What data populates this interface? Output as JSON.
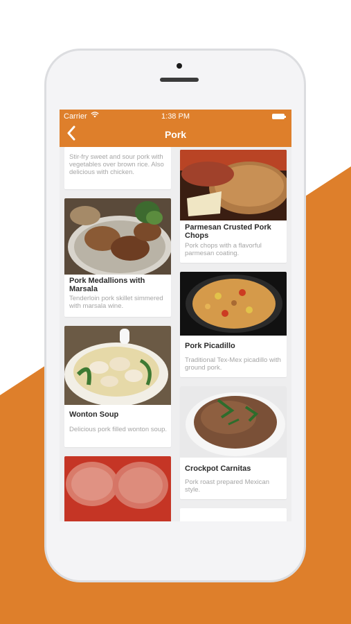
{
  "status_bar": {
    "carrier": "Carrier",
    "wifi": "wifi-icon",
    "time": "1:38 PM",
    "battery": "battery-icon"
  },
  "nav": {
    "back_icon": "chevron-left-icon",
    "title": "Pork"
  },
  "colors": {
    "accent": "#de7f2b",
    "card_bg": "#ffffff",
    "screen_bg": "#eeeeef"
  },
  "recipes": [
    {
      "title": "",
      "desc": "Stir-fry sweet and sour pork with vegetables over brown rice.  Also delicious with chicken."
    },
    {
      "title": "Parmesan Crusted Pork Chops",
      "desc": "Pork chops with a flavorful parmesan coating."
    },
    {
      "title": "Pork Medallions with Marsala",
      "desc": "Tenderloin pork skillet simmered with marsala wine."
    },
    {
      "title": "Pork Picadillo",
      "desc": "Traditional Tex-Mex picadillo with ground pork."
    },
    {
      "title": "Wonton Soup",
      "desc": "Delicious pork filled wonton soup."
    },
    {
      "title": "Crockpot Carnitas",
      "desc": "Pork roast prepared Mexican style."
    }
  ]
}
